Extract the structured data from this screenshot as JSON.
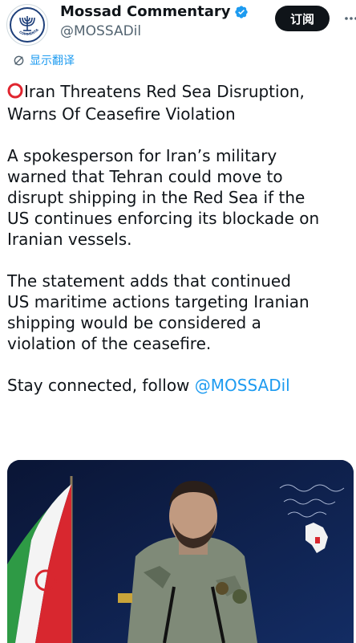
{
  "account": {
    "display_name": "Mossad Commentary",
    "handle": "@MOSSADil",
    "avatar_icon": "menorah-emblem-icon",
    "avatar_caption": "COMMENTARY",
    "verified_icon": "verified-badge-icon"
  },
  "header": {
    "subscribe_label": "订阅",
    "more_icon": "more-options-icon"
  },
  "translate": {
    "label": "显示翻译",
    "icon": "translate-icon"
  },
  "tweet": {
    "headline_icon": "red-circle-icon",
    "headline_line1": "Iran Threatens Red Sea Disruption,",
    "headline_line2": "Warns Of Ceasefire Violation",
    "p1_lines": [
      "A spokesperson for Iran’s military",
      "warned that Tehran could move to",
      "disrupt shipping in the Red Sea if the",
      "US continues enforcing its blockade on",
      "Iranian vessels."
    ],
    "p2_lines": [
      "The statement adds that continued",
      "US maritime actions targeting Iranian",
      "shipping would be considered a",
      "violation of the ceasefire."
    ],
    "cta_text": "Stay connected, follow ",
    "cta_mention": "@MOSSADil"
  },
  "media": {
    "description_icon": "video-frame-icon"
  },
  "colors": {
    "accent": "#1d9bf0",
    "text": "#0f1419",
    "secondary": "#536471",
    "alert_red": "#e0252f"
  }
}
